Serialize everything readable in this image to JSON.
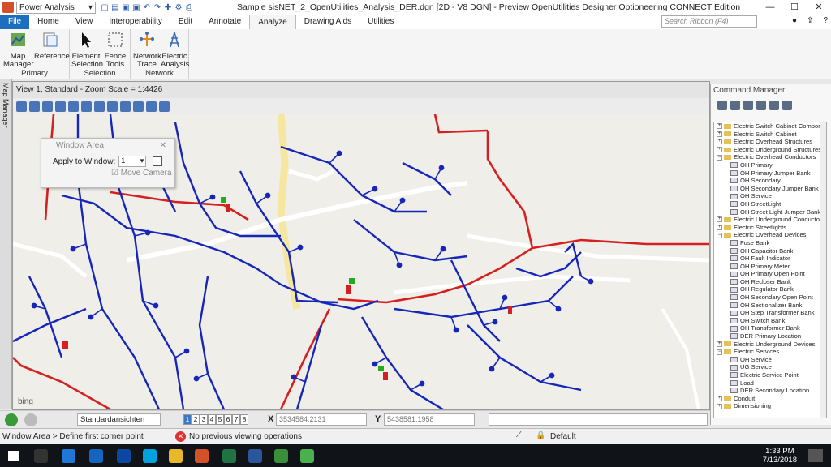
{
  "titlebar": {
    "workspace": "Power Analysis",
    "title": "Sample sisNET_2_OpenUtilities_Analysis_DER.dgn [2D - V8 DGN] - Preview OpenUtilities Designer Optioneering CONNECT Edition",
    "minimize": "—",
    "maximize": "☐",
    "close": "✕"
  },
  "tabs": [
    "File",
    "Home",
    "View",
    "Interoperability",
    "Edit",
    "Annotate",
    "Analyze",
    "Drawing Aids",
    "Utilities"
  ],
  "ribbon_search_placeholder": "Search Ribbon (F4)",
  "ribbon": {
    "primary": {
      "label": "Primary",
      "map_manager": "Map Manager",
      "reference": "Reference"
    },
    "selection": {
      "label": "Selection",
      "element_selection": "Element Selection",
      "fence_tools": "Fence Tools"
    },
    "network": {
      "label": "Network",
      "network_trace": "Network Trace",
      "electric_analysis": "Electric Analysis"
    }
  },
  "map_manager_tab": "Map Manager",
  "view": {
    "title": "View 1, Standard - Zoom Scale = 1:4426",
    "bing": "bing"
  },
  "window_area": {
    "title": "Window Area",
    "apply_label": "Apply to Window:",
    "apply_value": "1",
    "move_camera": "Move Camera"
  },
  "command_manager": {
    "title": "Command Manager",
    "tree": [
      {
        "label": "Electric Switch Cabinet Components",
        "type": "folder",
        "exp": "+"
      },
      {
        "label": "Electric Switch Cabinet",
        "type": "folder",
        "exp": "+"
      },
      {
        "label": "Electric Overhead Structures",
        "type": "folder",
        "exp": "+"
      },
      {
        "label": "Electric Underground Structures",
        "type": "folder",
        "exp": "+"
      },
      {
        "label": "Electric Overhead Conductors",
        "type": "folder",
        "exp": "−"
      },
      {
        "label": "OH Primary",
        "type": "leaf"
      },
      {
        "label": "OH Primary Jumper Bank",
        "type": "leaf"
      },
      {
        "label": "OH Secondary",
        "type": "leaf"
      },
      {
        "label": "OH Secondary Jumper Bank",
        "type": "leaf"
      },
      {
        "label": "OH Service",
        "type": "leaf"
      },
      {
        "label": "OH StreetLight",
        "type": "leaf"
      },
      {
        "label": "OH Street Light Jumper Bank",
        "type": "leaf"
      },
      {
        "label": "Electric Underground Conductors",
        "type": "folder",
        "exp": "+"
      },
      {
        "label": "Electric Streetlights",
        "type": "folder",
        "exp": "+"
      },
      {
        "label": "Electric Overhead Devices",
        "type": "folder",
        "exp": "−"
      },
      {
        "label": "Fuse Bank",
        "type": "leaf"
      },
      {
        "label": "OH Capacitor Bank",
        "type": "leaf"
      },
      {
        "label": "OH Fault Indicator",
        "type": "leaf"
      },
      {
        "label": "OH Primary Meter",
        "type": "leaf"
      },
      {
        "label": "OH Primary Open Point",
        "type": "leaf"
      },
      {
        "label": "OH Recloser Bank",
        "type": "leaf"
      },
      {
        "label": "OH Regulator Bank",
        "type": "leaf"
      },
      {
        "label": "OH Secondary Open Point",
        "type": "leaf"
      },
      {
        "label": "OH Sectionalizer Bank",
        "type": "leaf"
      },
      {
        "label": "OH Step Transformer Bank",
        "type": "leaf"
      },
      {
        "label": "OH Switch Bank",
        "type": "leaf"
      },
      {
        "label": "OH Transformer Bank",
        "type": "leaf"
      },
      {
        "label": "DER Primary Location",
        "type": "leaf"
      },
      {
        "label": "Electric Underground Devices",
        "type": "folder",
        "exp": "+"
      },
      {
        "label": "Electric Services",
        "type": "folder",
        "exp": "−"
      },
      {
        "label": "OH Service",
        "type": "leaf"
      },
      {
        "label": "UG Service",
        "type": "leaf"
      },
      {
        "label": "Electric Service Point",
        "type": "leaf"
      },
      {
        "label": "Load",
        "type": "leaf"
      },
      {
        "label": "DER Secondary Location",
        "type": "leaf"
      },
      {
        "label": "Conduit",
        "type": "folder",
        "exp": "+"
      },
      {
        "label": "Dimensioning",
        "type": "folder",
        "exp": "+"
      }
    ]
  },
  "bottom": {
    "view_group": "Standardansichten",
    "view_numbers": [
      "1",
      "2",
      "3",
      "4",
      "5",
      "6",
      "7",
      "8"
    ],
    "x_label": "X",
    "x_value": "3534584.2131",
    "y_label": "Y",
    "y_value": "5438581.1958"
  },
  "status": {
    "prompt": "Window Area > Define first corner point",
    "error": "No previous viewing operations",
    "level": "Default"
  },
  "taskbar": {
    "time": "1:33 PM",
    "date": "7/13/2018"
  },
  "colors": {
    "network": "#1626b8",
    "feeder": "#d42020",
    "accent": "#1e6ebf"
  }
}
